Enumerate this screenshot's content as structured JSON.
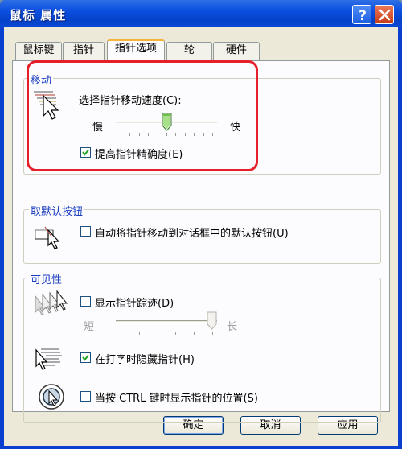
{
  "window": {
    "title": "鼠标 属性",
    "help_label": "?",
    "close_label": "×"
  },
  "tabs": [
    {
      "label": "鼠标键"
    },
    {
      "label": "指针"
    },
    {
      "label": "指针选项"
    },
    {
      "label": "轮"
    },
    {
      "label": "硬件"
    }
  ],
  "active_tab": "指针选项",
  "motion": {
    "title": "移动",
    "speed_label": "选择指针移动速度(C):",
    "slow": "慢",
    "fast": "快",
    "speed_value": 0.5,
    "precision_label": "提高指针精确度(E)",
    "precision_checked": true
  },
  "snap": {
    "title": "取默认按钮",
    "label": "自动将指针移动到对话框中的默认按钮(U)",
    "checked": false
  },
  "visibility": {
    "title": "可见性",
    "trails_label": "显示指针踪迹(D)",
    "trails_checked": false,
    "short": "短",
    "long": "长",
    "trail_value": 1.0,
    "hide_label": "在打字时隐藏指针(H)",
    "hide_checked": true,
    "ctrl_label": "当按 CTRL 键时显示指针的位置(S)",
    "ctrl_checked": false
  },
  "buttons": {
    "ok": "确定",
    "cancel": "取消",
    "apply": "应用"
  },
  "colors": {
    "titlebar": "#0b4fe0",
    "group_title": "#1c3fc0",
    "highlight": "#e6202a",
    "check": "#21a121"
  }
}
